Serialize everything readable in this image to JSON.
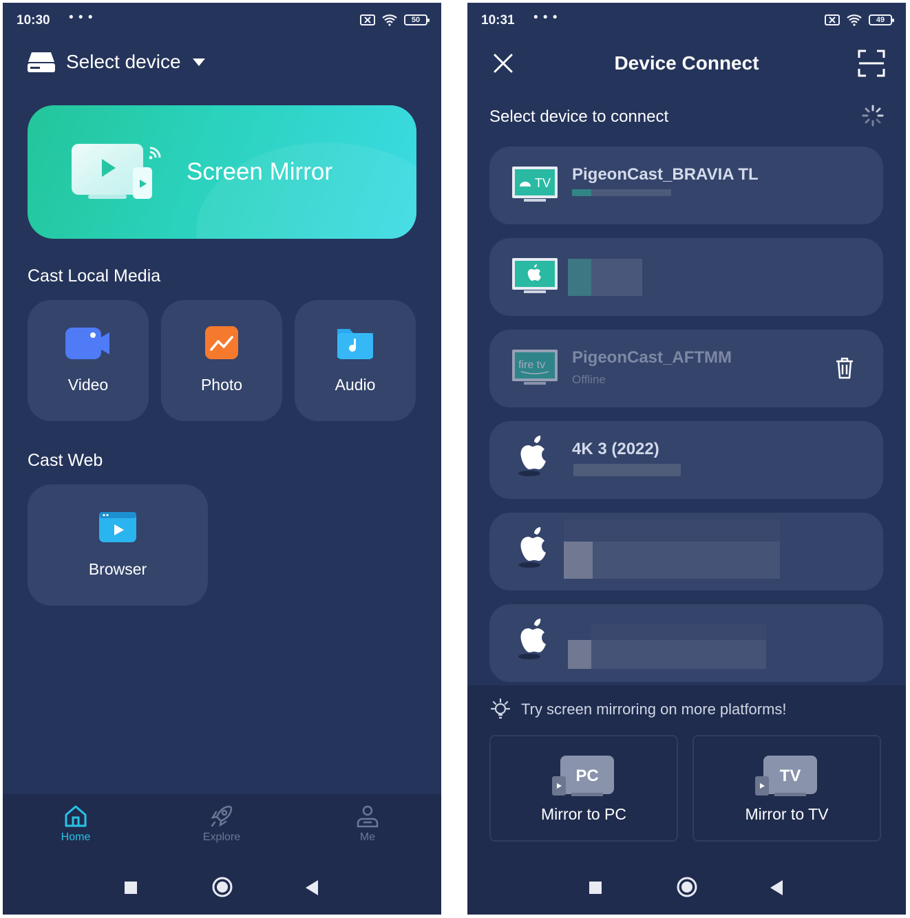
{
  "left": {
    "status": {
      "time": "10:30",
      "dots": "• • •",
      "battery": "50"
    },
    "header": {
      "title": "Select device"
    },
    "screen_mirror": {
      "label": "Screen Mirror"
    },
    "cast_local": {
      "title": "Cast Local Media",
      "items": [
        {
          "label": "Video"
        },
        {
          "label": "Photo"
        },
        {
          "label": "Audio"
        }
      ]
    },
    "cast_web": {
      "title": "Cast Web",
      "items": [
        {
          "label": "Browser"
        }
      ]
    },
    "nav": [
      {
        "label": "Home",
        "active": true
      },
      {
        "label": "Explore",
        "active": false
      },
      {
        "label": "Me",
        "active": false
      }
    ]
  },
  "right": {
    "status": {
      "time": "10:31",
      "dots": "• • •",
      "battery": "49"
    },
    "title": "Device Connect",
    "select_label": "Select device to connect",
    "devices": [
      {
        "name": "PigeonCast_BRAVIA TL",
        "status": "",
        "icon": "android-tv-icon"
      },
      {
        "name": "",
        "status": "",
        "icon": "apple-tv-icon"
      },
      {
        "name": "PigeonCast_AFTMM",
        "status": "Offline",
        "icon": "firetv-icon"
      },
      {
        "name": "4K 3 (2022)",
        "status": "",
        "icon": "apple-icon"
      },
      {
        "name": "",
        "status": "",
        "icon": "apple-icon"
      },
      {
        "name": "",
        "status": "",
        "icon": "apple-icon"
      }
    ],
    "firetv_text": "fire tv",
    "tv_badge": "TV",
    "tip": "Try screen mirroring on more platforms!",
    "mirror_options": [
      {
        "badge": "PC",
        "label": "Mirror to PC"
      },
      {
        "badge": "TV",
        "label": "Mirror to TV"
      }
    ]
  },
  "colors": {
    "background": "#25345a",
    "card": "#34446b",
    "accent": "#2ecfb0",
    "active_nav": "#29c3e6"
  }
}
